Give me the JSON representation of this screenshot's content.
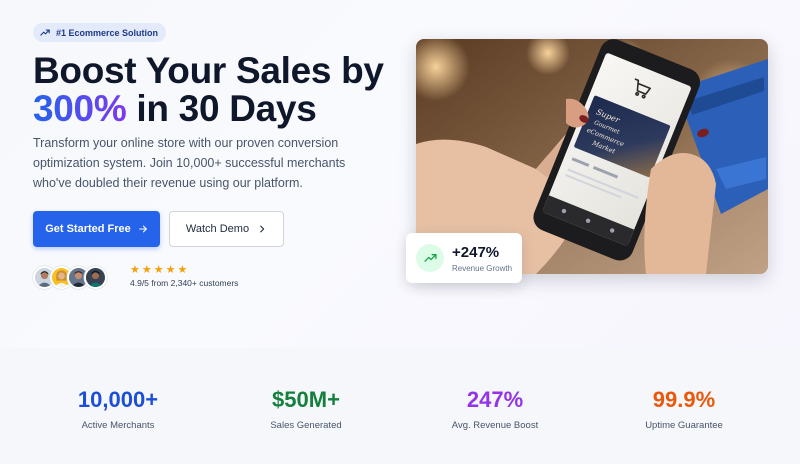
{
  "hero": {
    "badge": {
      "icon": "trending-up-icon",
      "text": "#1 Ecommerce Solution"
    },
    "headline": {
      "line1": "Boost Your Sales by",
      "accent": "300%",
      "line2_rest": " in 30 Days"
    },
    "description": "Transform your online store with our proven conversion optimization system. Join 10,000+ successful merchants who've doubled their revenue using our platform.",
    "primary_button": {
      "label": "Get Started Free",
      "icon": "arrow-right-icon"
    },
    "secondary_button": {
      "label": "Watch Demo",
      "icon": "chevron-right-icon"
    },
    "social_proof": {
      "avatars": [
        "customer-avatar-1",
        "customer-avatar-2",
        "customer-avatar-3",
        "customer-avatar-4"
      ],
      "stars": 5,
      "rating_text": "4.9/5 from 2,340+ customers"
    }
  },
  "showcase": {
    "image": "hand-holding-smartphone-shopping-app-photo",
    "growth_card": {
      "value": "+247%",
      "label": "Revenue Growth",
      "icon": "trending-up-icon"
    }
  },
  "stats": [
    {
      "value": "10,000+",
      "label": "Active Merchants",
      "color": "#1d4ed8"
    },
    {
      "value": "$50M+",
      "label": "Sales Generated",
      "color": "#15803d"
    },
    {
      "value": "247%",
      "label": "Avg. Revenue Boost",
      "color": "#9333ea"
    },
    {
      "value": "99.9%",
      "label": "Uptime Guarantee",
      "color": "#ea580c"
    }
  ],
  "colors": {
    "primary": "#2563eb",
    "accent_gradient": [
      "#2563eb",
      "#7c3aed"
    ],
    "star": "#f59e0b",
    "growth_badge_bg": "#dcfce7",
    "growth_icon": "#16a34a"
  }
}
